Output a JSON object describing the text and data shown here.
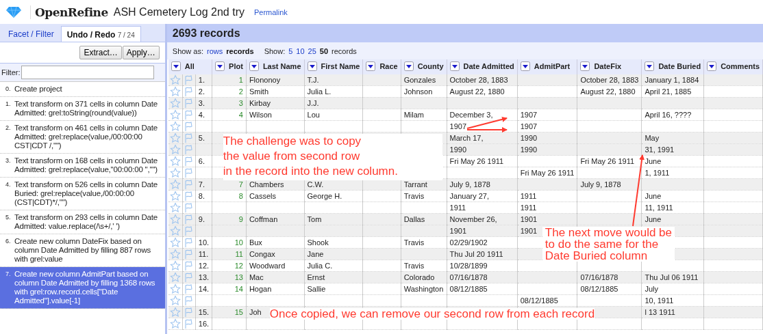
{
  "app": {
    "name": "OpenRefine",
    "project_title": "ASH Cemetery Log 2nd try",
    "permalink": "Permalink"
  },
  "left_panel": {
    "tabs": [
      {
        "label": "Facet / Filter",
        "selected": false
      },
      {
        "label": "Undo / Redo",
        "count": "7 / 24",
        "selected": true
      }
    ],
    "buttons": [
      "Extract…",
      "Apply…"
    ],
    "filter": {
      "label": "Filter:"
    },
    "history": [
      {
        "number": "0.",
        "text": "Create project",
        "selected": false
      },
      {
        "number": "1.",
        "text": "Text transform on 371 cells in column Date Admitted: grel:toString(round(value))",
        "selected": false
      },
      {
        "number": "2.",
        "text": "Text transform on 461 cells in column Date Admitted: grel:replace(value,/00:00:00 CST|CDT /,\"\")",
        "selected": false
      },
      {
        "number": "3.",
        "text": "Text transform on 168 cells in column Date Admitted: grel:replace(value,\"00:00:00 \",\"\")",
        "selected": false
      },
      {
        "number": "4.",
        "text": "Text transform on 526 cells in column Date Buried: grel:replace(value,/00:00:00 (CST|CDT)*/,\"\")",
        "selected": false
      },
      {
        "number": "5.",
        "text": "Text transform on 293 cells in column Date Admitted: value.replace(/\\s+/,' ')",
        "selected": false
      },
      {
        "number": "6.",
        "text": "Create new column DateFix based on column Date Admitted by filling 887 rows with grel:value",
        "selected": false
      },
      {
        "number": "7.",
        "text": "Create new column AdmitPart based on column Date Admitted by filling 1368 rows with grel:row.record.cells[\"Date Admitted\"].value[-1]",
        "selected": true
      }
    ]
  },
  "summary": "2693 records",
  "view_bar": {
    "show_as_label": "Show as:",
    "modes": [
      {
        "label": "rows",
        "selected": false
      },
      {
        "label": "records",
        "selected": true
      }
    ],
    "show_label": "Show:",
    "page_sizes": [
      {
        "label": "5",
        "selected": false
      },
      {
        "label": "10",
        "selected": false
      },
      {
        "label": "25",
        "selected": false
      },
      {
        "label": "50",
        "selected": true
      }
    ],
    "unit": "records"
  },
  "table": {
    "all_label": "All",
    "columns": [
      "Plot",
      "Last Name",
      "First Name",
      "Race",
      "County",
      "Date Admitted",
      "AdmitPart",
      "DateFix",
      "Date Buried",
      "Comments"
    ],
    "rows": [
      {
        "number": "1.",
        "cells": [
          "1",
          "Flononoy",
          "T.J.",
          "",
          "Gonzales",
          "October 28, 1883",
          "",
          "October 28, 1883",
          "January 1, 1884",
          ""
        ]
      },
      {
        "number": "2.",
        "cells": [
          "2",
          "Smith",
          "Julia L.",
          "",
          "Johnson",
          "August 22, 1880",
          "",
          "August 22, 1880",
          "April 21, 1885",
          ""
        ]
      },
      {
        "number": "3.",
        "cells": [
          "3",
          "Kirbay",
          "J.J.",
          "",
          "",
          "",
          "",
          "",
          "",
          ""
        ]
      },
      {
        "number": "4.",
        "cells": [
          "4",
          "Wilson",
          "Lou",
          "",
          "Milam",
          "December 3,",
          "1907",
          "",
          "April 16, ????",
          ""
        ]
      },
      {
        "number": "",
        "cells": [
          "",
          "",
          "",
          "",
          "",
          "1907",
          "1907",
          "",
          "",
          ""
        ]
      },
      {
        "number": "5.",
        "cells": [
          "",
          "",
          "",
          "",
          "",
          "March 17,",
          "1990",
          "",
          "May",
          ""
        ]
      },
      {
        "number": "",
        "cells": [
          "",
          "",
          "",
          "",
          "",
          "1990",
          "1990",
          "",
          "31, 1991",
          ""
        ]
      },
      {
        "number": "6.",
        "cells": [
          "",
          "",
          "",
          "",
          "",
          "Fri May 26 1911",
          "",
          "Fri May 26 1911",
          "June",
          ""
        ]
      },
      {
        "number": "",
        "cells": [
          "",
          "",
          "",
          "",
          "",
          "",
          "Fri May 26 1911",
          "",
          "1, 1911",
          ""
        ]
      },
      {
        "number": "7.",
        "cells": [
          "7",
          "Chambers",
          "C.W.",
          "",
          "Tarrant",
          "July 9, 1878",
          "",
          "July 9, 1878",
          "",
          ""
        ]
      },
      {
        "number": "8.",
        "cells": [
          "8",
          "Cassels",
          "George H.",
          "",
          "Travis",
          "January 27,",
          "1911",
          "",
          "June",
          ""
        ]
      },
      {
        "number": "",
        "cells": [
          "",
          "",
          "",
          "",
          "",
          "1911",
          "1911",
          "",
          "11, 1911",
          ""
        ]
      },
      {
        "number": "9.",
        "cells": [
          "9",
          "Coffman",
          "Tom",
          "",
          "Dallas",
          "November 26,",
          "1901",
          "",
          "June",
          ""
        ]
      },
      {
        "number": "",
        "cells": [
          "",
          "",
          "",
          "",
          "",
          "1901",
          "1901",
          "",
          "",
          ""
        ]
      },
      {
        "number": "10.",
        "cells": [
          "10",
          "Bux",
          "Shook",
          "",
          "Travis",
          "02/29/1902",
          "",
          "",
          "",
          ""
        ]
      },
      {
        "number": "11.",
        "cells": [
          "11",
          "Congax",
          "Jane",
          "",
          "",
          "Thu Jul 20 1911",
          "",
          "",
          "",
          ""
        ]
      },
      {
        "number": "12.",
        "cells": [
          "12",
          "Woodward",
          "Julia C.",
          "",
          "Travis",
          "10/28/1899",
          "",
          "",
          "",
          ""
        ]
      },
      {
        "number": "13.",
        "cells": [
          "13",
          "Mac",
          "Ernst",
          "",
          "Colorado",
          "07/16/1878",
          "",
          "07/16/1878",
          "Thu Jul 06  1911",
          ""
        ]
      },
      {
        "number": "14.",
        "cells": [
          "14",
          "Hogan",
          "Sallie",
          "",
          "Washington",
          "08/12/1885",
          "",
          "08/12/1885",
          "July",
          ""
        ]
      },
      {
        "number": "",
        "cells": [
          "",
          "",
          "",
          "",
          "",
          "",
          "08/12/1885",
          "",
          "10, 1911",
          ""
        ]
      },
      {
        "number": "15.",
        "cells": [
          "15",
          "Joh",
          "",
          "",
          "",
          "",
          "",
          "",
          "l 13  1911",
          ""
        ]
      },
      {
        "number": "16.",
        "cells": [
          "",
          "",
          "",
          "",
          "",
          "",
          "",
          "",
          "",
          ""
        ]
      }
    ]
  },
  "annotations": [
    "The challenge was to copy\nthe value from second row\nin the record into the new column.",
    "The next move would be\nto do the same for the\nDate Buried column",
    "Once copied, we can remove our second row from each record"
  ]
}
